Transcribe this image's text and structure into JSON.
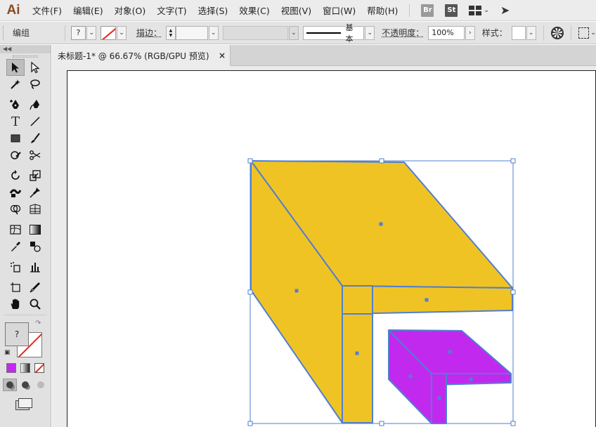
{
  "app": {
    "logo": "Ai"
  },
  "menu": [
    {
      "label": "文件(F)",
      "name": "menu-file"
    },
    {
      "label": "编辑(E)",
      "name": "menu-edit"
    },
    {
      "label": "对象(O)",
      "name": "menu-object"
    },
    {
      "label": "文字(T)",
      "name": "menu-type"
    },
    {
      "label": "选择(S)",
      "name": "menu-select"
    },
    {
      "label": "效果(C)",
      "name": "menu-effect"
    },
    {
      "label": "视图(V)",
      "name": "menu-view"
    },
    {
      "label": "窗口(W)",
      "name": "menu-window"
    },
    {
      "label": "帮助(H)",
      "name": "menu-help"
    }
  ],
  "menu_apps": {
    "bridge": "Br",
    "stock": "St"
  },
  "control": {
    "selection_type": "编组",
    "fill_value": "?",
    "stroke_label": "描边：",
    "stroke_profile": "基本",
    "opacity_label": "不透明度：",
    "opacity_value": "100%",
    "style_label": "样式："
  },
  "document": {
    "tab_title": "未标题-1* @ 66.67% (RGB/GPU 预览)",
    "close": "×"
  },
  "tools": {
    "fill_value": "?"
  },
  "colors": {
    "yellow": "#f0c325",
    "magenta": "#c229ee",
    "outline": "#4f7fd1",
    "selection": "#4f7fd1"
  }
}
